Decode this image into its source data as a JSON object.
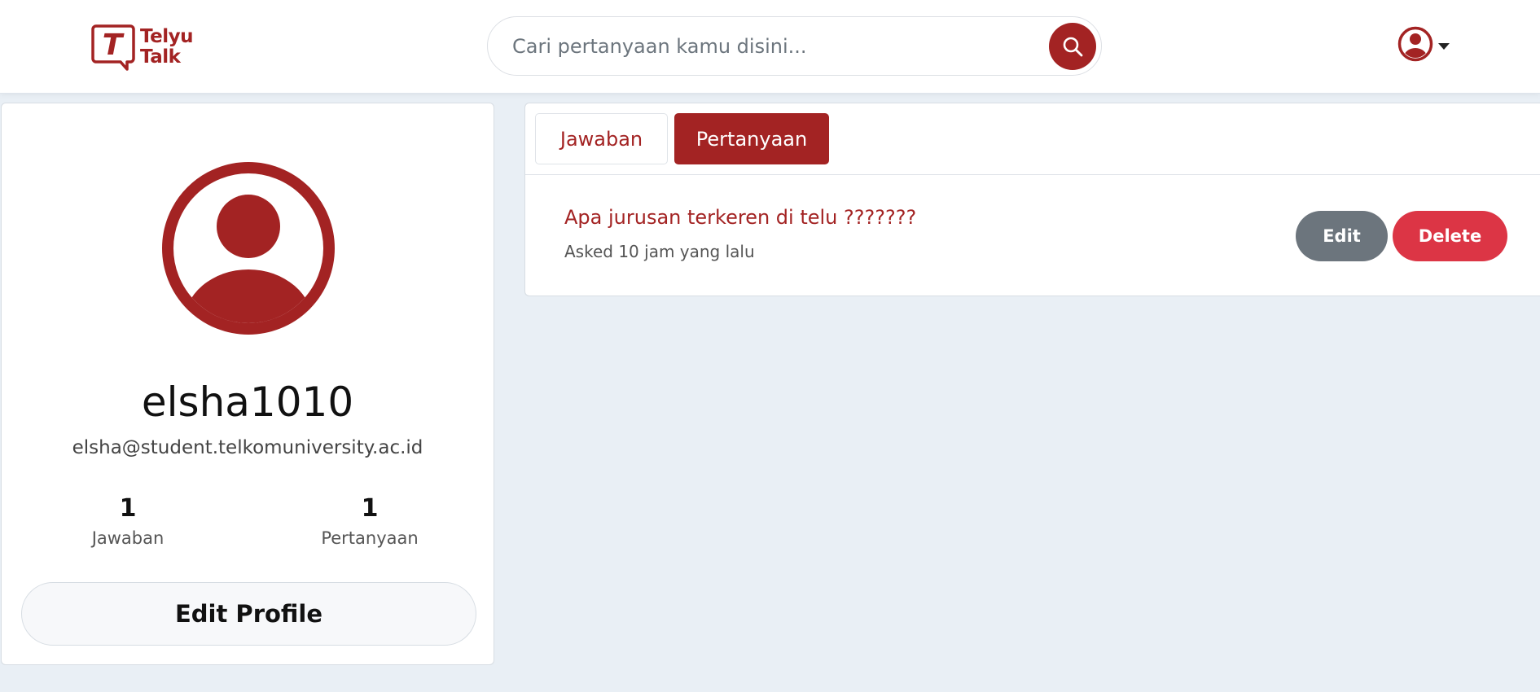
{
  "header": {
    "logo": {
      "line1": "Telyu",
      "line2": "Talk",
      "mark": "T"
    },
    "search": {
      "placeholder": "Cari pertanyaan kamu disini..."
    },
    "user_menu": {
      "icon": "user-circle-icon"
    }
  },
  "profile": {
    "username": "elsha1010",
    "email": "elsha@student.telkomuniversity.ac.id",
    "stats": [
      {
        "value": "1",
        "label": "Jawaban"
      },
      {
        "value": "1",
        "label": "Pertanyaan"
      }
    ],
    "edit_button": "Edit Profile"
  },
  "content": {
    "tabs": [
      {
        "label": "Jawaban",
        "active": false
      },
      {
        "label": "Pertanyaan",
        "active": true
      }
    ],
    "questions": [
      {
        "title": "Apa jurusan terkeren di telu ???????",
        "meta": "Asked 10 jam yang lalu",
        "edit_label": "Edit",
        "delete_label": "Delete"
      }
    ]
  },
  "colors": {
    "brand": "#a32323",
    "background": "#e9eff5",
    "edit_button": "#6c757d",
    "delete_button": "#dc3545"
  }
}
